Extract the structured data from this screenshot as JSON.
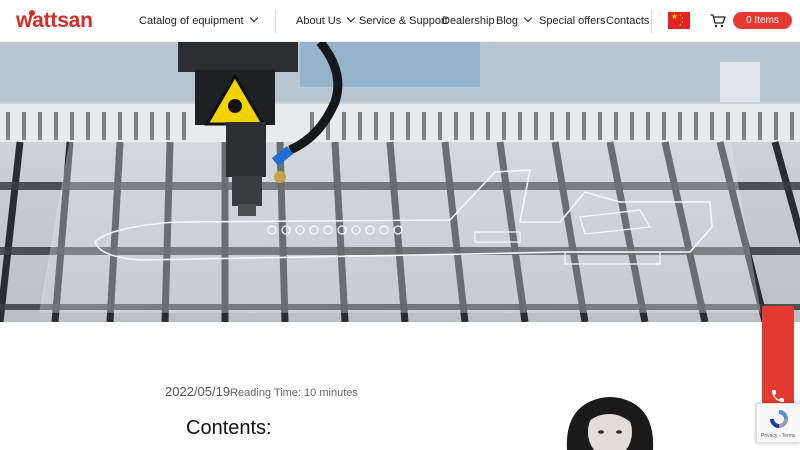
{
  "brand": {
    "logo_text": "wattsan",
    "accent_color": "#e53a31"
  },
  "nav": {
    "catalog": "Catalog of equipment",
    "about": "About Us",
    "service": "Service & Support",
    "dealership": "Dealership",
    "blog": "Blog",
    "offers": "Special offers",
    "contacts": "Contacts"
  },
  "header": {
    "language_flag": "china-flag-icon",
    "cart_icon": "cart-icon",
    "items_label": "0 Items"
  },
  "article": {
    "date": "2022/05/19",
    "reading_time": "Reading Time: 10 minutes",
    "contents_title": "Contents:"
  },
  "widgets": {
    "call_icon": "phone-icon",
    "recaptcha_text": "Privacy - Terms"
  }
}
